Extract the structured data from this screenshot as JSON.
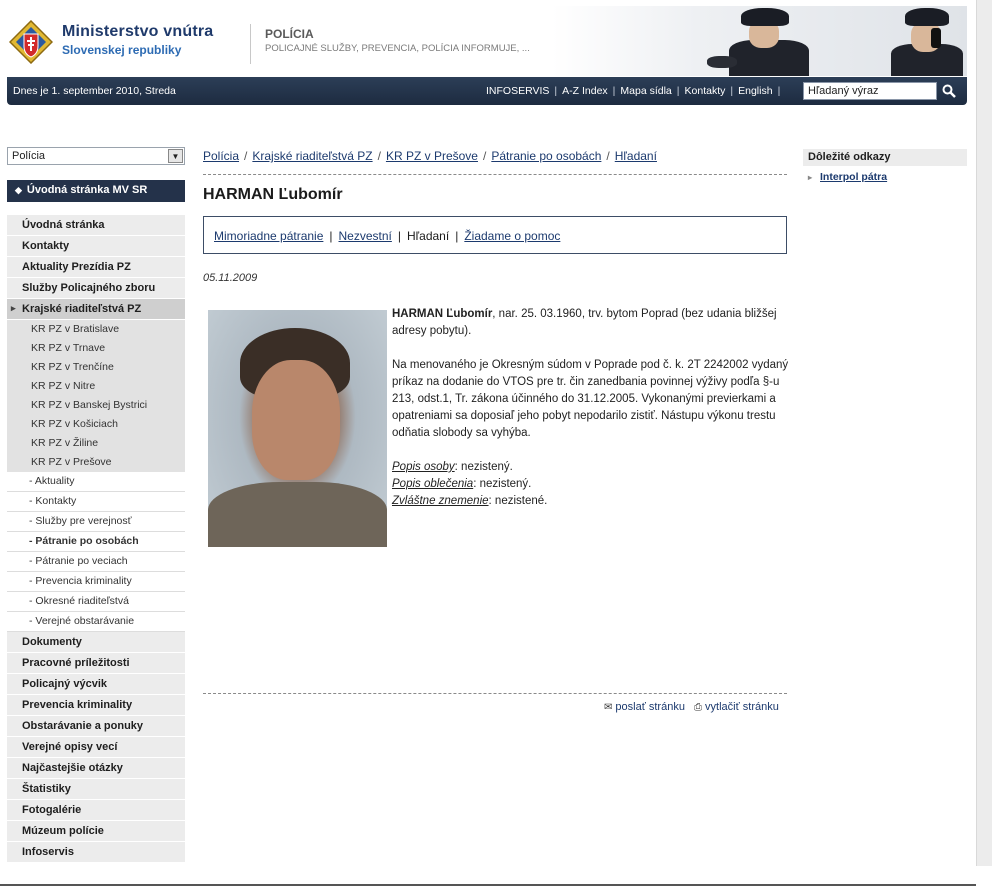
{
  "header": {
    "ministry_line1": "Ministerstvo vnútra",
    "ministry_line2": "Slovenskej republiky",
    "section_title": "POLÍCIA",
    "section_subtitle": "POLICAJNÉ SLUŽBY, PREVENCIA, POLÍCIA INFORMUJE, ...",
    "crest_icon": "state-crest-icon"
  },
  "navbar": {
    "date_text": "Dnes je 1. september 2010, Streda",
    "links": [
      "INFOSERVIS",
      "A-Z Index",
      "Mapa sídla",
      "Kontakty",
      "English"
    ],
    "search_placeholder": "Hľadaný výraz",
    "search_icon": "magnifier-icon"
  },
  "sidebar": {
    "dropdown_value": "Polícia",
    "home_button": "Úvodná stránka MV SR",
    "menu": [
      "Úvodná stránka",
      "Kontakty",
      "Aktuality Prezídia PZ",
      "Služby Policajného zboru",
      "Krajské riaditeľstvá PZ"
    ],
    "regions": [
      "KR PZ v Bratislave",
      "KR PZ v Trnave",
      "KR PZ v Trenčíne",
      "KR PZ v Nitre",
      "KR PZ v Banskej Bystrici",
      "KR PZ v Košiciach",
      "KR PZ v Žiline",
      "KR PZ v Prešove"
    ],
    "presov_sub": [
      "- Aktuality",
      "- Kontakty",
      "- Služby pre verejnosť",
      "- Pátranie po osobách",
      "- Pátranie po veciach",
      "- Prevencia kriminality",
      "- Okresné riaditeľstvá",
      "- Verejné obstarávanie"
    ],
    "menu_bottom": [
      "Dokumenty",
      "Pracovné príležitosti",
      "Policajný výcvik",
      "Prevencia kriminality",
      "Obstarávanie a ponuky",
      "Verejné opisy vecí",
      "Najčastejšie otázky",
      "Štatistiky",
      "Fotogalérie",
      "Múzeum polície",
      "Infoservis"
    ]
  },
  "breadcrumb": [
    "Polícia",
    "Krajské riaditeľstvá PZ",
    "KR PZ v Prešove",
    "Pátranie po osobách",
    "Hľadaní"
  ],
  "main": {
    "title": "HARMAN Ľubomír",
    "tabs": [
      "Mimoriadne pátranie",
      "Nezvestní",
      "Hľadaní",
      "Žiadame o pomoc"
    ],
    "date": "05.11.2009",
    "name_bold": "HARMAN Ľubomír",
    "intro_rest": ", nar. 25. 03.1960, trv. bytom Poprad (bez udania bližšej adresy pobytu).",
    "paragraph": "Na menovaného je Okresným súdom v Poprade pod č. k. 2T 2242002 vydaný príkaz na dodanie do VTOS pre tr. čin zanedbania povinnej výživy podľa §-u 213, odst.1, Tr. zákona účinného do 31.12.2005. Vykonanými previerkami a opatreniami sa doposiaľ jeho pobyt nepodarilo zistiť. Nástupu výkonu trestu odňatia slobody sa vyhýba.",
    "details": [
      {
        "label": "Popis osoby",
        "value": ": nezistený."
      },
      {
        "label": "Popis oblečenia",
        "value": ": nezistený."
      },
      {
        "label": "Zvláštne znemenie",
        "value": ": nezistené."
      }
    ],
    "send_page": "poslať stránku",
    "print_page": "vytlačiť stránku"
  },
  "right_column": {
    "heading": "Dôležité odkazy",
    "links": [
      "Interpol pátra"
    ]
  }
}
